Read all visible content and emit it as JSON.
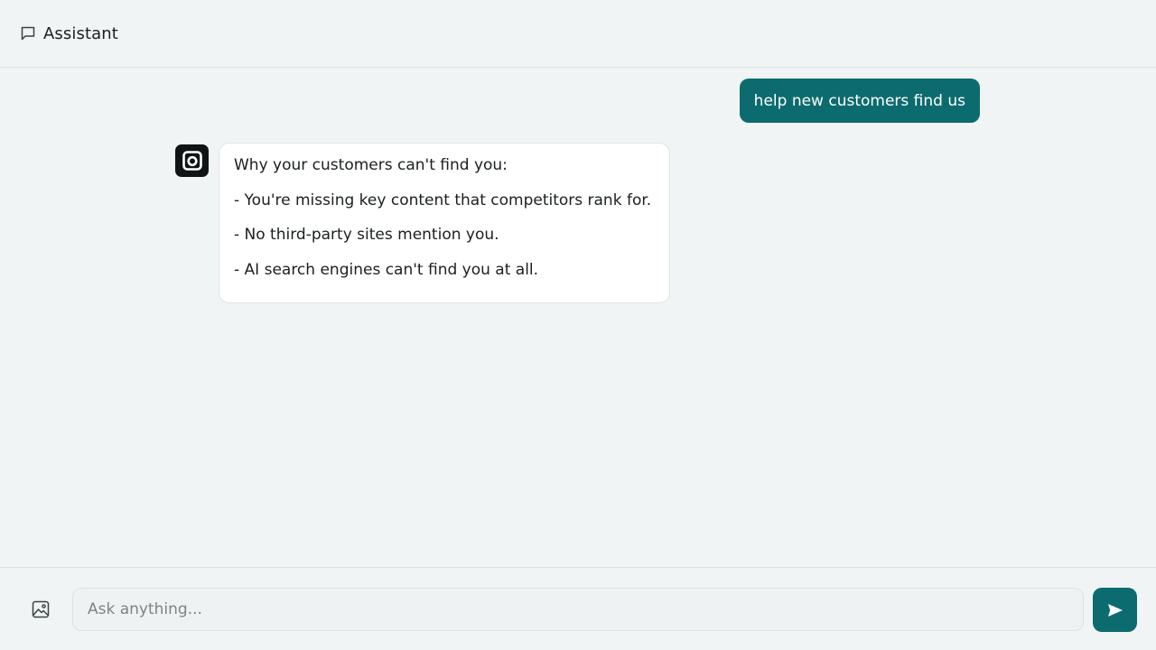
{
  "header": {
    "icon": "chat-bubble-icon",
    "title": "Assistant"
  },
  "messages": {
    "user": {
      "text": "help new customers find us"
    },
    "assistant": {
      "avatar_icon": "assistant-logo-icon",
      "lines": [
        "Why your customers can't find you:",
        "- You're missing key content that competitors rank for.",
        "- No third-party sites mention you.",
        "- AI search engines can't find you at all."
      ]
    }
  },
  "composer": {
    "attach_icon": "image-icon",
    "input_value": "",
    "input_placeholder": "Ask anything...",
    "send_icon": "send-icon"
  },
  "colors": {
    "accent": "#0c6b6e",
    "background": "#f0f4f4",
    "avatar_bg": "#0f1414"
  }
}
